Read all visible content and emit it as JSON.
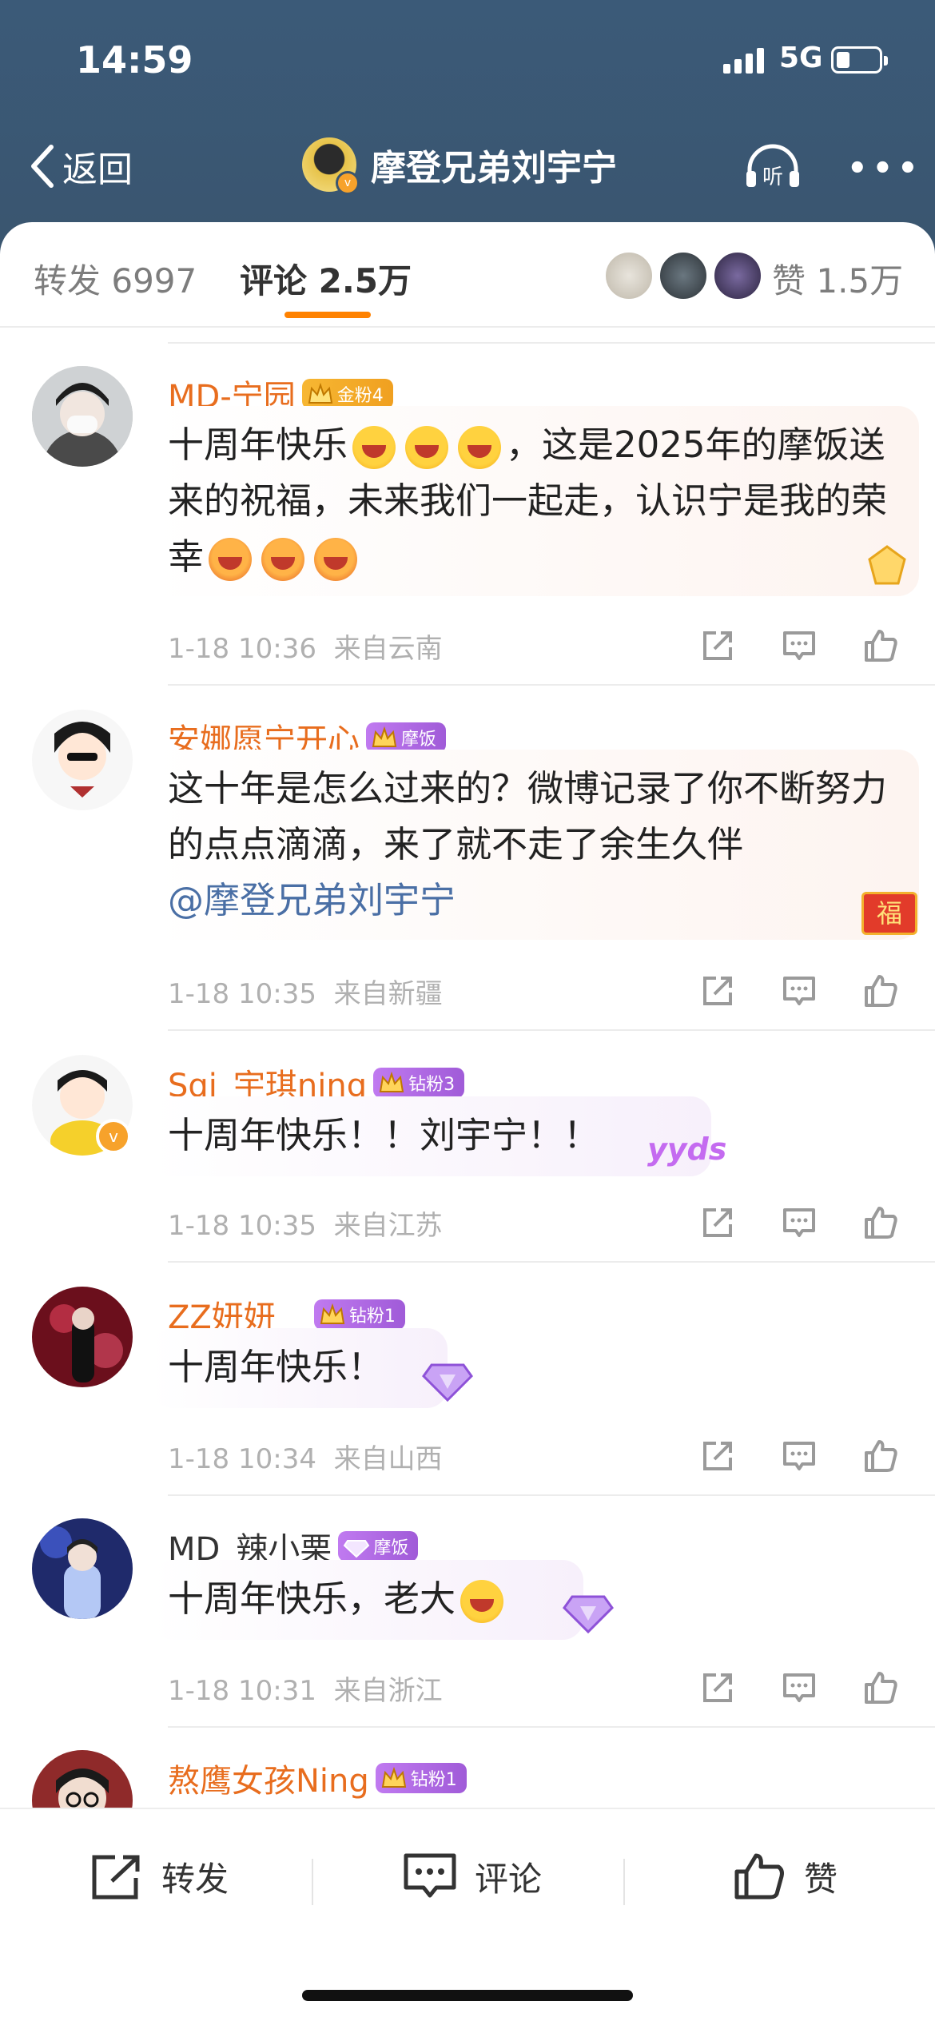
{
  "status_bar": {
    "time": "14:59",
    "network": "5G"
  },
  "nav": {
    "back_label": "返回",
    "title": "摩登兄弟刘宇宁",
    "listen_label": "听",
    "more_label": "•••"
  },
  "tabs": {
    "repost": "转发 6997",
    "comment": "评论 2.5万",
    "like": "赞 1.5万"
  },
  "comments": [
    {
      "username": "MD-宁园",
      "badge": "金粉4",
      "text_parts": [
        "十周年快乐",
        "，这是2025年的摩饭送来的祝福，未来我们一起走，认识宁是我的荣幸"
      ],
      "time": "1-18 10:36",
      "location": "来自云南"
    },
    {
      "username": "安娜愿宁开心",
      "badge": "摩饭",
      "text": "这十年是怎么过来的？微博记录了你不断努力的点点滴滴，来了就不走了余生久伴",
      "mention": "@摩登兄弟刘宇宁",
      "deco_char": "福",
      "time": "1-18 10:35",
      "location": "来自新疆"
    },
    {
      "username": "Sqi_宇琪ning",
      "badge": "钻粉3",
      "text": "十周年快乐！！刘宇宁！！",
      "deco_text": "yyds",
      "time": "1-18 10:35",
      "location": "来自江苏"
    },
    {
      "username": "ZZ妍妍__",
      "badge": "钻粉1",
      "text": "十周年快乐！",
      "time": "1-18 10:34",
      "location": "来自山西"
    },
    {
      "username": "MD_辣小栗",
      "badge": "摩饭",
      "text": "十周年快乐，老大",
      "time": "1-18 10:31",
      "location": "来自浙江"
    },
    {
      "username": "熬鹰女孩Ning",
      "badge": "钻粉1"
    }
  ],
  "bottom_bar": {
    "repost": "转发",
    "comment": "评论",
    "like": "赞"
  },
  "colors": {
    "header_bg": "#3b5a78",
    "accent": "#ff8200",
    "username": "#e86d1e",
    "mention": "#4a6fa5"
  }
}
